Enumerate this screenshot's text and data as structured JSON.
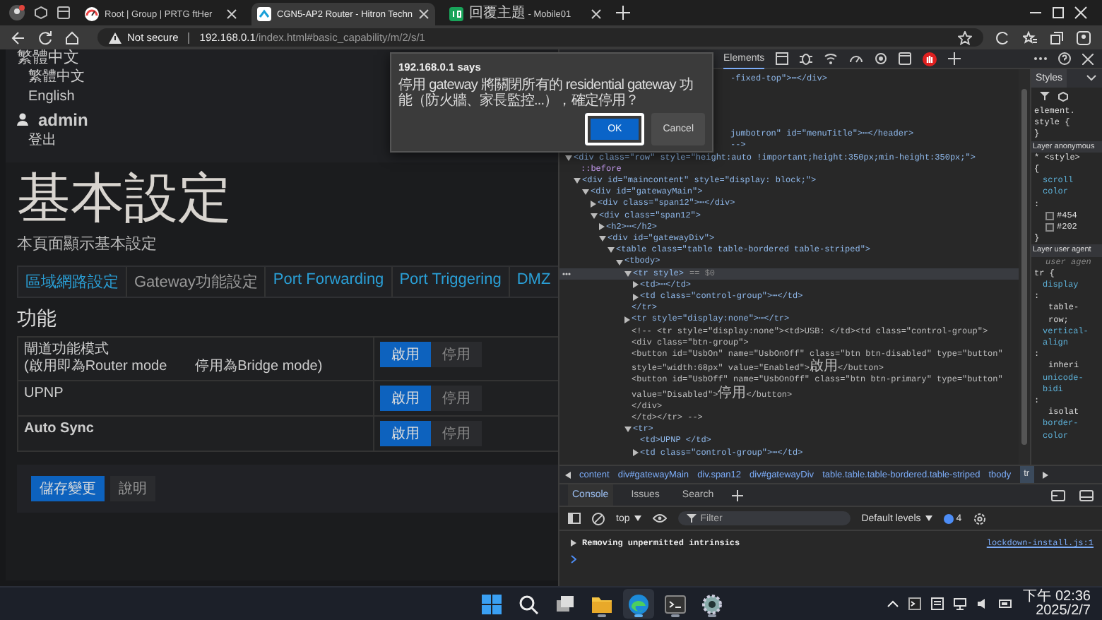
{
  "browser": {
    "tabs": [
      {
        "title": "Root | Group | PRTG ftHer",
        "kind": "gauge",
        "selected": false
      },
      {
        "title": "CGN5-AP2 Router - Hitron Techn",
        "kind": "router",
        "selected": true
      },
      {
        "title": "回覆主題 - Mobile01",
        "kind": "mobile01",
        "selected": false
      }
    ],
    "address": {
      "security": "Not secure",
      "host": "192.168.0.1",
      "path": "/index.html#basic_capability/m/2/s/1"
    }
  },
  "page": {
    "language_menu": {
      "current": "繁體中文",
      "options": [
        "繁體中文",
        "English"
      ]
    },
    "user_menu": {
      "user": "admin",
      "options": [
        "登出"
      ]
    },
    "title": "基本設定",
    "subtitle": "本頁面顯示基本設定",
    "tabs": [
      {
        "label": "區域網路設定",
        "selected": false
      },
      {
        "label": "Gateway功能設定",
        "selected": true
      },
      {
        "label": "Port Forwarding",
        "selected": false
      },
      {
        "label": "Port Triggering",
        "selected": false
      },
      {
        "label": "DMZ",
        "selected": false
      }
    ],
    "section_title": "功能",
    "settings": [
      {
        "label": "閘道功能模式",
        "note": "(啟用即為Router mode　　停用為Bridge mode)",
        "bold": false,
        "options": [
          {
            "label": "啟用",
            "selected": true
          },
          {
            "label": "停用",
            "selected": false
          }
        ]
      },
      {
        "label": "UPNP",
        "bold": false,
        "options": [
          {
            "label": "啟用",
            "selected": true
          },
          {
            "label": "停用",
            "selected": false
          }
        ]
      },
      {
        "label": "Auto Sync",
        "bold": true,
        "options": [
          {
            "label": "啟用",
            "selected": true
          },
          {
            "label": "停用",
            "selected": false
          }
        ]
      }
    ],
    "actions": [
      {
        "label": "儲存變更",
        "kind": "primary"
      },
      {
        "label": "說明",
        "kind": "default"
      }
    ]
  },
  "dialog": {
    "title": "192.168.0.1 says",
    "message": "停用 gateway 將關閉所有的 residential gateway 功能（防火牆、家長監控...），確定停用？",
    "buttons": [
      {
        "label": "OK",
        "kind": "primary",
        "focused": true
      },
      {
        "label": "Cancel",
        "kind": "secondary",
        "focused": false
      }
    ]
  },
  "devtools": {
    "panel_tabs": [
      {
        "label": "Elements",
        "selected": true
      }
    ],
    "dom_tree": [
      {
        "text": "-fixed-top\">⋯</div>",
        "kind": "partial"
      },
      {
        "text": "jumbotron\" id=\"menuTitle\">⋯</header>",
        "kind": "partial"
      },
      {
        "text": "-->",
        "kind": "partial"
      },
      {
        "text": "<div class=\"row\" style=\"height:auto !important;height:350px;min-height:350px;\">",
        "kind": "element",
        "expanded": true,
        "children": [
          {
            "text": "::before",
            "kind": "pseudo"
          },
          {
            "text": "<div id=\"maincontent\" style=\"display: block;\">",
            "kind": "element",
            "expanded": true,
            "children": [
              {
                "text": "<div id=\"gatewayMain\">",
                "kind": "element",
                "expanded": true,
                "children": [
                  {
                    "text": "<div class=\"span12\">⋯</div>",
                    "kind": "element",
                    "expanded": false
                  },
                  {
                    "text": "<div class=\"span12\">",
                    "kind": "element",
                    "expanded": true,
                    "children": [
                      {
                        "text": "<h2>⋯</h2>",
                        "kind": "element",
                        "expanded": false
                      },
                      {
                        "text": "<div id=\"gatewayDiv\">",
                        "kind": "element",
                        "expanded": true,
                        "children": [
                          {
                            "text": "<table class=\"table table-bordered table-striped\">",
                            "kind": "element",
                            "expanded": true,
                            "children": [
                              {
                                "text": "<tbody>",
                                "kind": "element",
                                "expanded": true,
                                "children": [
                                  {
                                    "text": "<tr style>",
                                    "note": "== $0",
                                    "kind": "element",
                                    "expanded": true,
                                    "selected": true,
                                    "closing": "</tr>",
                                    "children": [
                                      {
                                        "text": "<td>⋯</td>",
                                        "kind": "element",
                                        "expanded": false
                                      },
                                      {
                                        "text": "<td class=\"control-group\">⋯</td>",
                                        "kind": "element",
                                        "expanded": false
                                      }
                                    ]
                                  },
                                  {
                                    "text": "<tr style=\"display:none\">⋯</tr>",
                                    "kind": "element",
                                    "expanded": false
                                  },
                                  {
                                    "text": "<!-- <tr style=\"display:none\"><td>USB: </td><td class=\"control-group\">",
                                    "kind": "comment"
                                  },
                                  {
                                    "text": "<div class=\"btn-group\">",
                                    "kind": "comment"
                                  },
                                  {
                                    "text": "<button id=\"UsbOn\" name=\"UsbOnOff\" class=\"btn btn-disabled\" type=\"button\"",
                                    "kind": "comment"
                                  },
                                  {
                                    "text": "style=\"width:68px\" value=\"Enabled\">啟用</button>",
                                    "kind": "comment"
                                  },
                                  {
                                    "text": "<button id=\"UsbOff\" name=\"UsbOnOff\" class=\"btn btn-primary\" type=\"button\"",
                                    "kind": "comment"
                                  },
                                  {
                                    "text": "value=\"Disabled\">停用</button>",
                                    "kind": "comment"
                                  },
                                  {
                                    "text": "</div>",
                                    "kind": "comment"
                                  },
                                  {
                                    "text": "</td></tr>  -->",
                                    "kind": "comment"
                                  },
                                  {
                                    "text": "<tr>",
                                    "kind": "element",
                                    "expanded": true,
                                    "children": [
                                      {
                                        "text": "<td>UPNP </td>",
                                        "kind": "element"
                                      },
                                      {
                                        "text": "<td class=\"control-group\">⋯</td>",
                                        "kind": "element",
                                        "expanded": false
                                      }
                                    ]
                                  }
                                ]
                              }
                            ]
                          }
                        ]
                      }
                    ]
                  }
                ]
              }
            ]
          }
        ]
      }
    ],
    "styles_tab": "Styles",
    "styles_lines": [
      {
        "text": "element.",
        "kind": "plain"
      },
      {
        "text": "style {",
        "kind": "plain"
      },
      {
        "text": "}",
        "kind": "plain"
      },
      {
        "text": "Layer anonymous",
        "kind": "header"
      },
      {
        "text": "* <style>",
        "kind": "plain"
      },
      {
        "text": "{",
        "kind": "plain"
      },
      {
        "text": "scroll",
        "kind": "property"
      },
      {
        "text": "color",
        "kind": "property"
      },
      {
        "text": ":",
        "kind": "plain"
      },
      {
        "text": "#454",
        "kind": "swatch"
      },
      {
        "text": "#202",
        "kind": "swatch"
      },
      {
        "text": "}",
        "kind": "plain"
      },
      {
        "text": "Layer user agent",
        "kind": "header"
      },
      {
        "text": "user agen",
        "kind": "source"
      },
      {
        "text": "tr {",
        "kind": "plain"
      },
      {
        "text": "display",
        "kind": "property"
      },
      {
        "text": ":",
        "kind": "plain"
      },
      {
        "text": "table-",
        "kind": "value"
      },
      {
        "text": "row;",
        "kind": "value"
      },
      {
        "text": "vertical-",
        "kind": "property"
      },
      {
        "text": "align",
        "kind": "property"
      },
      {
        "text": ":",
        "kind": "plain"
      },
      {
        "text": "inheri",
        "kind": "value"
      },
      {
        "text": "unicode-",
        "kind": "property"
      },
      {
        "text": "bidi",
        "kind": "property"
      },
      {
        "text": ":",
        "kind": "plain"
      },
      {
        "text": "isolat",
        "kind": "value"
      },
      {
        "text": "border-",
        "kind": "property"
      },
      {
        "text": "color",
        "kind": "property"
      }
    ],
    "breadcrumbs": [
      {
        "label": "content",
        "selected": false
      },
      {
        "label": "div#gatewayMain",
        "selected": false
      },
      {
        "label": "div.span12",
        "selected": false
      },
      {
        "label": "div#gatewayDiv",
        "selected": false
      },
      {
        "label": "table.table.table-bordered.table-striped",
        "selected": false
      },
      {
        "label": "tbody",
        "selected": false
      },
      {
        "label": "tr",
        "selected": true
      }
    ],
    "drawer_tabs": [
      {
        "label": "Console",
        "selected": true
      },
      {
        "label": "Issues",
        "selected": false
      },
      {
        "label": "Search",
        "selected": false
      }
    ],
    "console": {
      "context": "top",
      "filter_placeholder": "Filter",
      "levels": "Default levels",
      "issues_count": "4",
      "messages": [
        {
          "text": "Removing unpermitted intrinsics",
          "source": "lockdown-install.js:1",
          "expanded": false
        }
      ]
    }
  },
  "taskbar": {
    "apps": [
      {
        "kind": "start",
        "running": false,
        "active": false
      },
      {
        "kind": "search",
        "running": false,
        "active": false
      },
      {
        "kind": "taskview",
        "running": false,
        "active": false
      },
      {
        "kind": "explorer",
        "running": true,
        "active": false
      },
      {
        "kind": "edge",
        "running": true,
        "active": true
      },
      {
        "kind": "terminal",
        "running": true,
        "active": false
      },
      {
        "kind": "settings",
        "running": true,
        "active": false
      }
    ],
    "time": "下午 02:36",
    "date": "2025/2/7"
  }
}
